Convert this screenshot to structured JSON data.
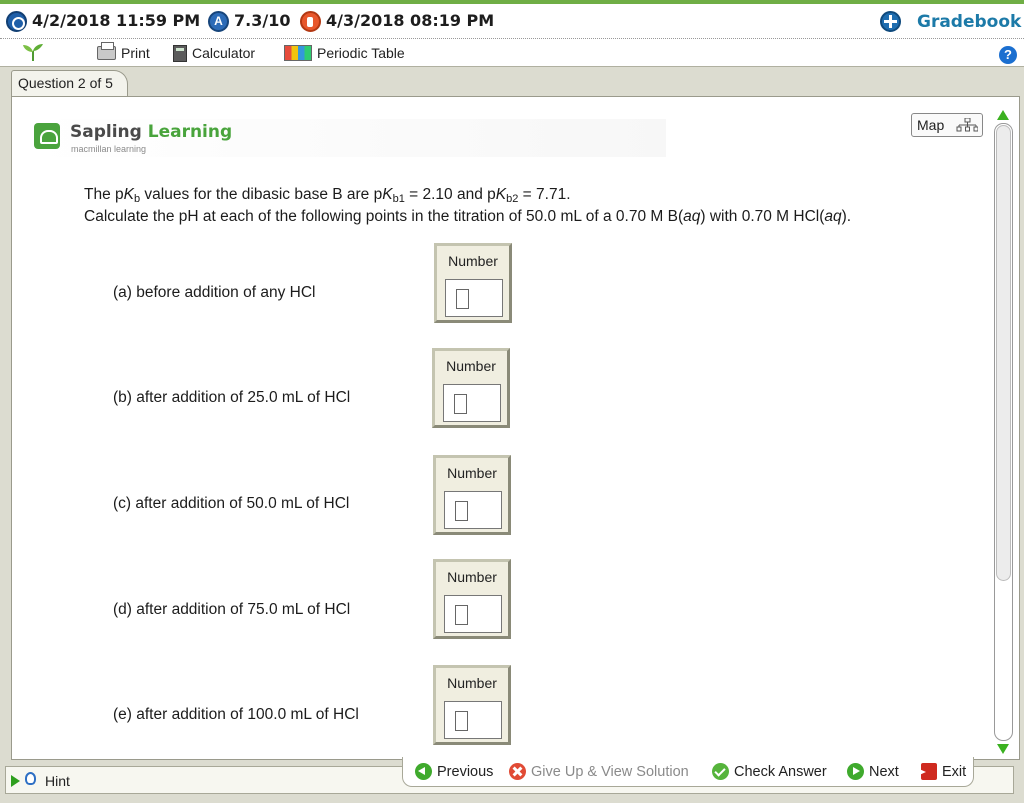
{
  "header": {
    "due_date": "4/2/2018 11:59 PM",
    "score": "7.3/10",
    "score_icon_letter": "A",
    "late_date": "4/3/2018 08:19 PM",
    "gradebook": "Gradebook"
  },
  "toolbar": {
    "print": "Print",
    "calculator": "Calculator",
    "periodic_table": "Periodic Table",
    "help_symbol": "?"
  },
  "question_tab": "Question 2 of 5",
  "map_label": "Map",
  "logo": {
    "sapling": "Sapling",
    "learning": "Learning",
    "tagline": "macmillan learning"
  },
  "problem": {
    "line1_prefix": "The p",
    "K": "K",
    "b": "b",
    "line1_mid1": " values for the dibasic base B are p",
    "b1": "b1",
    "val1": " = 2.10 and p",
    "b2": "b2",
    "val2": " = 7.71.",
    "line2_prefix": "Calculate the pH at each of the following points in the titration of 50.0 mL of a 0.70 M B(",
    "aq": "aq",
    "line2_mid": ") with 0.70 M HCl(",
    "line2_end": ")."
  },
  "parts": [
    {
      "label": "(a) before addition of any HCl",
      "widget_title": "Number",
      "value": ""
    },
    {
      "label": "(b) after addition of 25.0 mL of HCl",
      "widget_title": "Number",
      "value": ""
    },
    {
      "label": "(c) after addition of 50.0 mL of HCl",
      "widget_title": "Number",
      "value": ""
    },
    {
      "label": "(d) after addition of 75.0 mL of HCl",
      "widget_title": "Number",
      "value": ""
    },
    {
      "label": "(e) after addition of 100.0 mL of HCl",
      "widget_title": "Number",
      "value": ""
    }
  ],
  "bottom": {
    "hint": "Hint",
    "previous": "Previous",
    "give_up": "Give Up & View Solution",
    "check_answer": "Check Answer",
    "next": "Next",
    "exit": "Exit"
  },
  "colors": {
    "brand_green": "#49a43c",
    "gradebook_blue": "#1c7aa8",
    "scroll_green": "#3bb120"
  }
}
